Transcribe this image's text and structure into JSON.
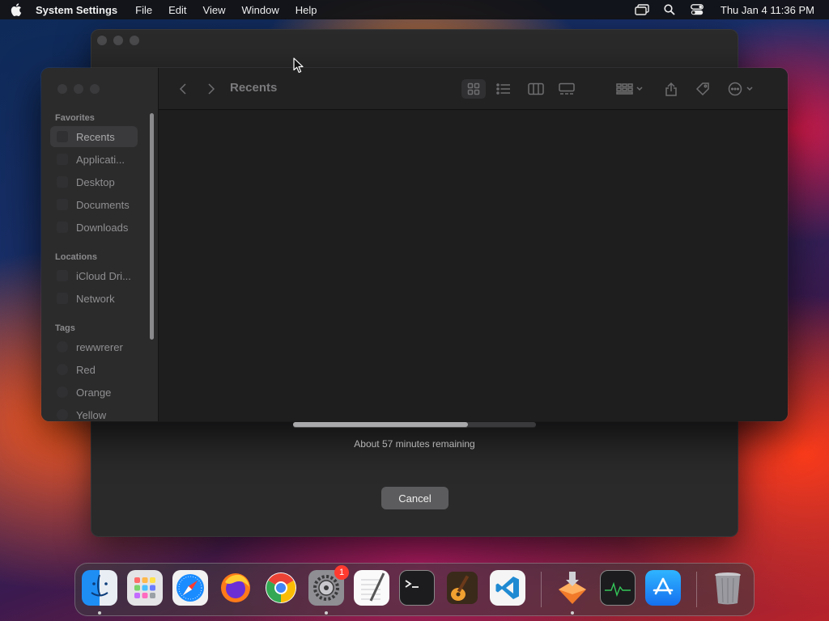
{
  "menubar": {
    "app_name": "System Settings",
    "menus": [
      "File",
      "Edit",
      "View",
      "Window",
      "Help"
    ],
    "clock": "Thu Jan 4  11:36 PM"
  },
  "copy_dialog": {
    "remaining": "About 57 minutes remaining",
    "progress": 0.72,
    "cancel_label": "Cancel"
  },
  "finder": {
    "title": "Recents",
    "sidebar": {
      "favorites_title": "Favorites",
      "favorites": [
        "Recents",
        "Applicati...",
        "Desktop",
        "Documents",
        "Downloads"
      ],
      "locations_title": "Locations",
      "locations": [
        "iCloud Dri...",
        "Network"
      ],
      "tags_title": "Tags",
      "tags": [
        "rewwrerer",
        "Red",
        "Orange",
        "Yellow"
      ]
    },
    "horizontal_scroll": 0.72
  },
  "dock": {
    "apps": [
      "Finder",
      "Launchpad",
      "Safari",
      "Firefox",
      "Chrome",
      "System Settings",
      "TextEdit",
      "Terminal",
      "GarageBand",
      "VS Code",
      "Installer",
      "Activity Monitor",
      "App Store",
      "Trash"
    ],
    "settings_badge": "1"
  },
  "colors": {
    "accent_badge": "#ff3b30"
  }
}
